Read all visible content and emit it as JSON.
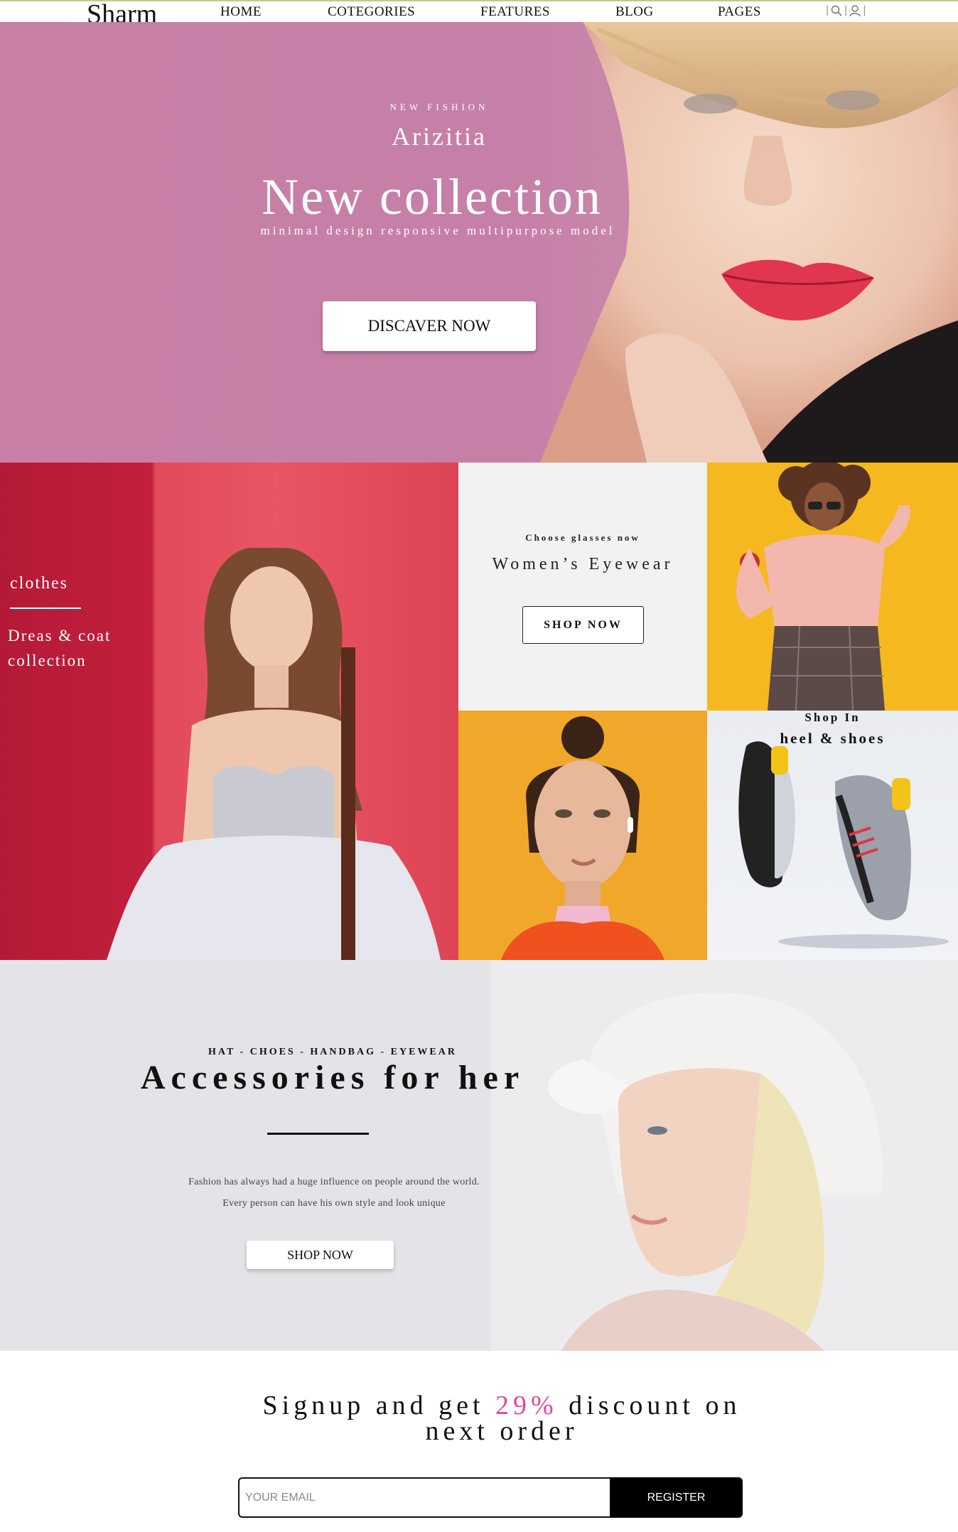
{
  "nav": {
    "logo": "Sharm",
    "links": [
      "HOME",
      "COTEGORIES",
      "FEATURES",
      "BLOG",
      "PAGES"
    ],
    "icons": [
      "search-icon",
      "user-icon"
    ]
  },
  "hero": {
    "overline": "NEW FISHION",
    "brand": "Arizitia",
    "title": "New collection",
    "subtitle": "minimal design responsive multipurpose model",
    "button": "DISCAVER NOW"
  },
  "categories": {
    "clothes": {
      "label": "clothes",
      "title": "Dreas & coat collection"
    },
    "eyewear": {
      "overline": "Choose glasses now",
      "title": "Women’s Eyewear",
      "button": "SHOP NOW"
    },
    "shoes": {
      "overline": "Shop In",
      "title": "heel & shoes"
    }
  },
  "accessories": {
    "overline": "HAT - CHOES - HANDBAG - EYEWEAR",
    "title": "Accessories for her",
    "text_line1": "Fashion has always had a huge influence on people around the world.",
    "text_line2": "Every person can have his own style and look unique",
    "button": "SHOP NOW"
  },
  "signup": {
    "title_before": "Signup and get",
    "discount": "29%",
    "title_after": "discount on",
    "title_line2": "next order",
    "email_placeholder": "YOUR EMAIL",
    "register": "REGISTER"
  },
  "colors": {
    "accent_pink": "#e0499b",
    "hero_bg": "#c77fa5",
    "red_panel": "#e24a5c",
    "eyewear_bg": "#f2f2f2",
    "yellow_panel": "#f6b81f",
    "orange_panel": "#f1a72a",
    "accessories_bg": "#e4e4e8"
  }
}
